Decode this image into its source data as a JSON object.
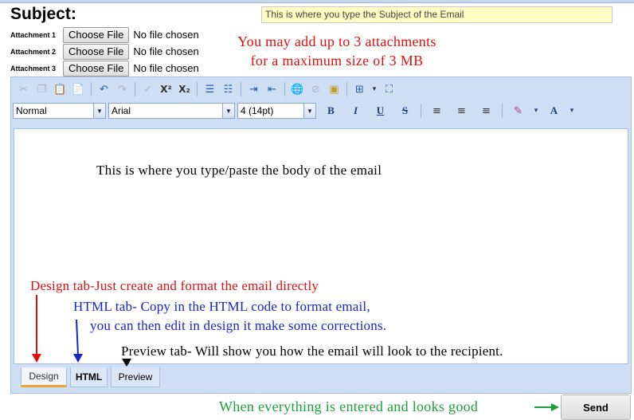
{
  "subject": {
    "label": "Subject:",
    "value": "This is where you type the Subject of the Email"
  },
  "attachments": [
    {
      "label": "Attachment 1",
      "button": "Choose File",
      "status": "No file chosen"
    },
    {
      "label": "Attachment 2",
      "button": "Choose File",
      "status": "No file chosen"
    },
    {
      "label": "Attachment 3",
      "button": "Choose File",
      "status": "No file chosen"
    }
  ],
  "attachment_note": {
    "line1": "You may add up to 3 attachments",
    "line2": "for a maximum size of 3 MB"
  },
  "toolbar": {
    "superscript": "X²",
    "subscript": "X₂",
    "paragraph_style": "Normal",
    "font_name": "Arial",
    "font_size": "4 (14pt)",
    "bold": "B",
    "italic": "I",
    "underline": "U",
    "strike": "S",
    "font_color": "A"
  },
  "editor": {
    "body_text": "This is where you type/paste the body of the email"
  },
  "annotations": {
    "design": "Design tab-Just create and format the email directly",
    "html_line1": "HTML tab- Copy in the HTML code to format email,",
    "html_line2": "you can then edit in design it make some corrections.",
    "preview": "Preview tab- Will show you how the email will look to the recipient."
  },
  "tabs": [
    {
      "label": "Design",
      "active": true
    },
    {
      "label": "HTML",
      "active": false
    },
    {
      "label": "Preview",
      "active": false
    }
  ],
  "send_note": "When everything is entered and looks good",
  "send_button": "Send",
  "colors": {
    "note_red": "#e01010",
    "note_blue": "#1a25c8",
    "note_green": "#1aa037",
    "editor_frame": "#cfdff3",
    "subject_bg": "#fdfdc4"
  }
}
